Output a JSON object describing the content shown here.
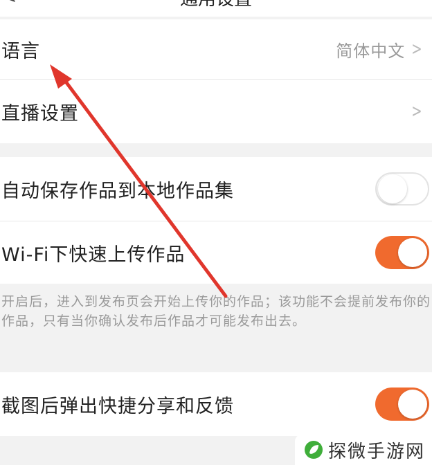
{
  "header": {
    "back_icon": "back-chevron-icon",
    "title": "通用设置"
  },
  "settings": {
    "language": {
      "label": "语言",
      "value": "简体中文"
    },
    "live": {
      "label": "直播设置"
    },
    "auto_save": {
      "label": "自动保存作品到本地作品集",
      "enabled": false
    },
    "wifi_upload": {
      "label": "Wi-Fi下快速上传作品",
      "enabled": true,
      "description": "开启后，进入到发布页会开始上传你的作品；该功能不会提前发布你的作品，只有当你确认发布后作品才可能发布出去。"
    },
    "screenshot_share": {
      "label": "截图后弹出快捷分享和反馈",
      "enabled": true
    }
  },
  "colors": {
    "accent": "#f06a2e",
    "arrow": "#e0362c",
    "watermark_leaf": "#3fae3a"
  },
  "watermark": {
    "text": "探微手游网",
    "icon": "leaf-logo-icon"
  }
}
